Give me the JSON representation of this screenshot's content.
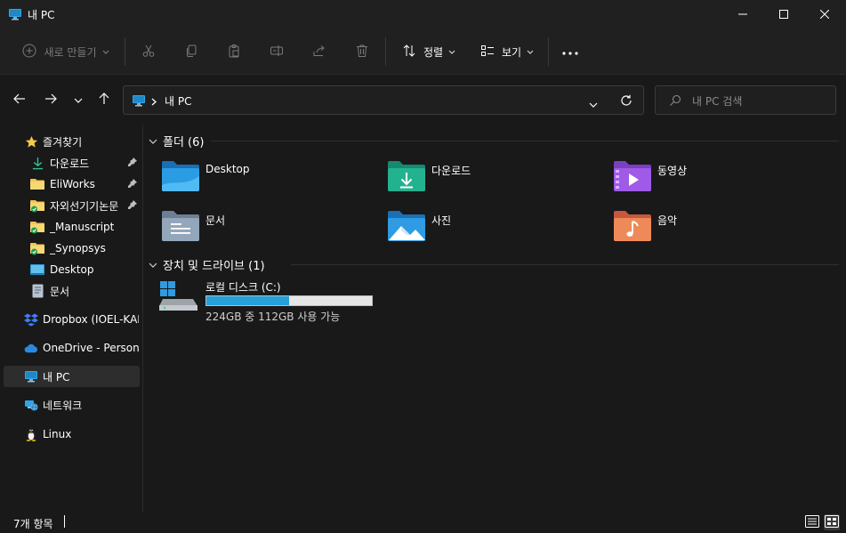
{
  "window": {
    "title": "내 PC"
  },
  "toolbar": {
    "new_label": "새로 만들기",
    "sort_label": "정렬",
    "view_label": "보기"
  },
  "address": {
    "crumb": "내 PC"
  },
  "search": {
    "placeholder": "내 PC 검색"
  },
  "sidebar": {
    "favorites": "즐겨찾기",
    "items": [
      {
        "label": "다운로드"
      },
      {
        "label": "EliWorks"
      },
      {
        "label": "자외선기기논문"
      },
      {
        "label": "_Manuscript"
      },
      {
        "label": "_Synopsys"
      },
      {
        "label": "Desktop"
      },
      {
        "label": "문서"
      }
    ],
    "dropbox": "Dropbox (IOEL-KAIST)",
    "onedrive": "OneDrive - Personal",
    "thispc": "내 PC",
    "network": "네트워크",
    "linux": "Linux"
  },
  "folders": {
    "header": "폴더 (6)",
    "items": [
      {
        "label": "Desktop"
      },
      {
        "label": "다운로드"
      },
      {
        "label": "동영상"
      },
      {
        "label": "문서"
      },
      {
        "label": "사진"
      },
      {
        "label": "음악"
      }
    ]
  },
  "drives": {
    "header": "장치 및 드라이브 (1)",
    "items": [
      {
        "label": "로컬 디스크 (C:)",
        "usage": "224GB 중 112GB 사용 가능",
        "used_fraction": 0.5
      }
    ]
  },
  "status": {
    "count": "7개 항목"
  },
  "colors": {
    "accent": "#26a0da",
    "background": "#191919",
    "chrome": "#202020"
  }
}
